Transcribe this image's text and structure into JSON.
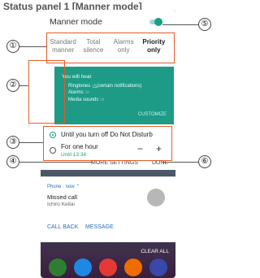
{
  "heading": "Status panel 1 [Manner mode]",
  "panel": {
    "title": "Manner mode",
    "modes": [
      {
        "line1": "Standard",
        "line2": "manner"
      },
      {
        "line1": "Total",
        "line2": "silence"
      },
      {
        "line1": "Alarms",
        "line2": "only"
      },
      {
        "line1": "Priority",
        "line2": "only"
      }
    ],
    "hear": {
      "title": "You will hear",
      "rows": [
        "Ringtones :△(certain notifications)",
        "Alarms :○",
        "Media sounds :○"
      ],
      "customize": "CUSTOMIZE"
    },
    "options": {
      "until_off": "Until you turn off Do Not Disturb",
      "one_hour": "For one hour",
      "until_time": "Until 13:34",
      "minus": "−",
      "plus": "+"
    },
    "more_settings": "MORE SETTINGS",
    "done": "DONE"
  },
  "notification": {
    "app": "Phone · now ⌃",
    "title": "Missed call",
    "name": "Ichiro Keitai",
    "call_back": "CALL BACK",
    "message": "MESSAGE"
  },
  "clear_all": "CLEAR ALL",
  "callouts": [
    "①",
    "②",
    "③",
    "④",
    "⑤",
    "⑥"
  ],
  "colors": {
    "accent": "#16a085",
    "highlight_box": "#e55c2a"
  }
}
